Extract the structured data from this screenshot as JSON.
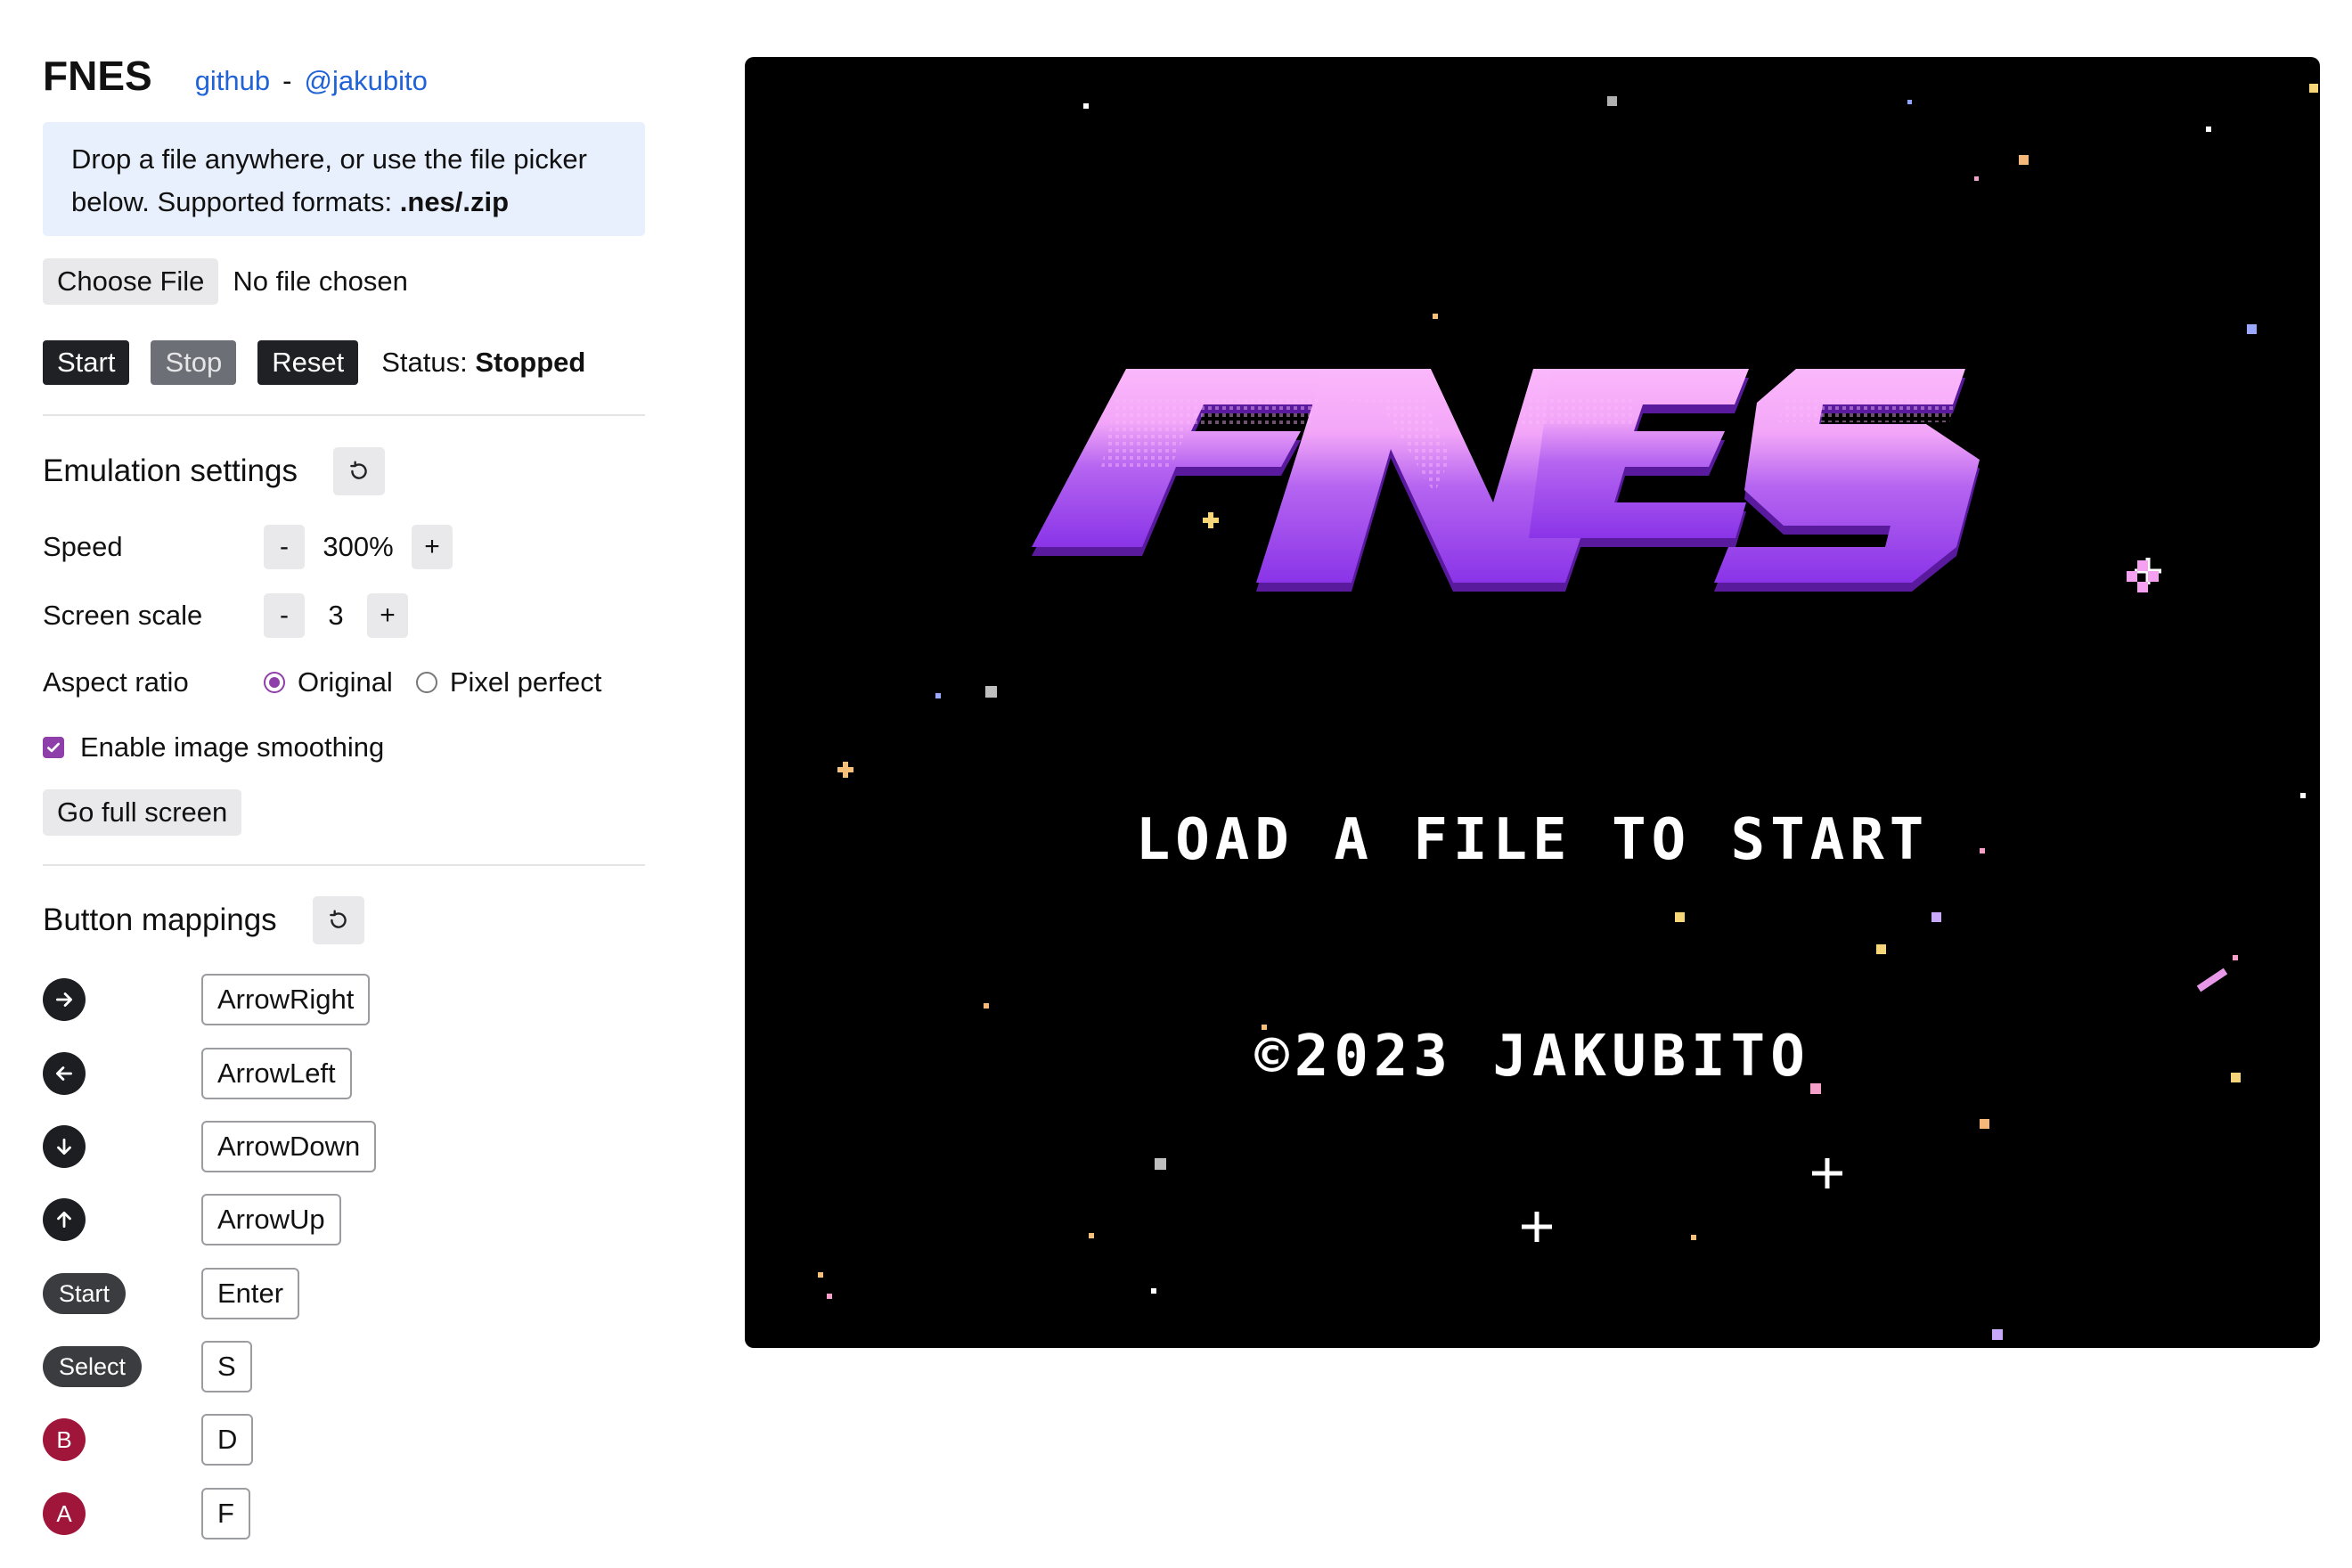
{
  "header": {
    "title": "FNES",
    "github_link": "github",
    "separator": "-",
    "author_link": "@jakubito"
  },
  "info": {
    "text_before": "Drop a file anywhere, or use the file picker below. Supported formats: ",
    "formats": ".nes/.zip"
  },
  "file_picker": {
    "button_label": "Choose File",
    "status_text": "No file chosen"
  },
  "controls": {
    "start_label": "Start",
    "stop_label": "Stop",
    "reset_label": "Reset",
    "status_label": "Status:",
    "status_value": "Stopped"
  },
  "emulation": {
    "title": "Emulation settings",
    "reset_icon": "reset-icon",
    "speed": {
      "label": "Speed",
      "minus": "-",
      "value": "300%",
      "plus": "+"
    },
    "screen_scale": {
      "label": "Screen scale",
      "minus": "-",
      "value": "3",
      "plus": "+"
    },
    "aspect_ratio": {
      "label": "Aspect ratio",
      "options": [
        "Original",
        "Pixel perfect"
      ],
      "selected": "Original"
    },
    "smoothing": {
      "label": "Enable image smoothing",
      "checked": true
    },
    "fullscreen_label": "Go full screen"
  },
  "mappings": {
    "title": "Button mappings",
    "reset_icon": "reset-icon",
    "items": [
      {
        "control": "right",
        "icon": "arrow-right-icon",
        "key": "ArrowRight"
      },
      {
        "control": "left",
        "icon": "arrow-left-icon",
        "key": "ArrowLeft"
      },
      {
        "control": "down",
        "icon": "arrow-down-icon",
        "key": "ArrowDown"
      },
      {
        "control": "up",
        "icon": "arrow-up-icon",
        "key": "ArrowUp"
      },
      {
        "control": "start",
        "label": "Start",
        "key": "Enter"
      },
      {
        "control": "select",
        "label": "Select",
        "key": "S"
      },
      {
        "control": "b",
        "label": "B",
        "key": "D"
      },
      {
        "control": "a",
        "label": "A",
        "key": "F"
      }
    ]
  },
  "screen": {
    "logo_text": "FNES",
    "message": "LOAD A FILE TO START",
    "copyright": "©2023 JAKUBITO",
    "colors": {
      "background": "#000000",
      "logo_top": "#fbb8fb",
      "logo_bottom": "#8a34e8",
      "logo_shadow": "#5a1a9e",
      "text": "#ffffff"
    }
  },
  "colors": {
    "link": "#1f63d6",
    "info_bg": "#e8f0fd",
    "accent": "#8e3fa9",
    "dark_button": "#1f2124",
    "red_button": "#a0163a"
  }
}
